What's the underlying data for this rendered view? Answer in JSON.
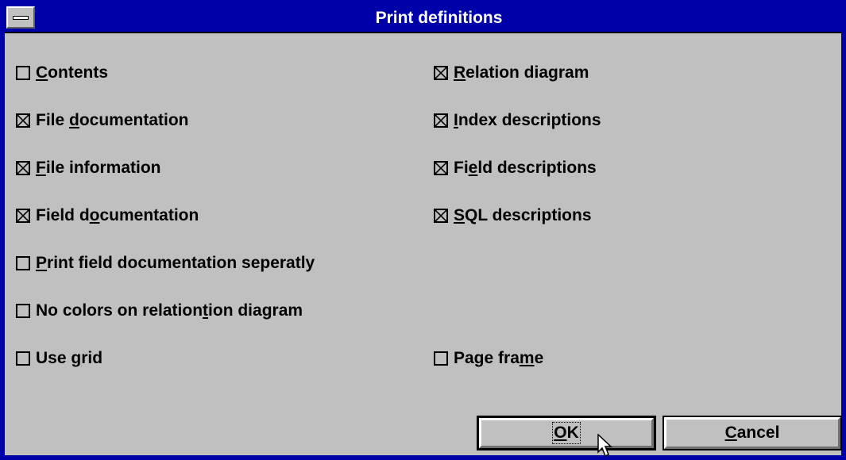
{
  "window": {
    "title": "Print definitions"
  },
  "options": [
    {
      "key": "contents",
      "before": "",
      "accel": "C",
      "after": "ontents",
      "checked": false
    },
    {
      "key": "file-doc",
      "before": "File ",
      "accel": "d",
      "after": "ocumentation",
      "checked": true
    },
    {
      "key": "file-info",
      "before": "",
      "accel": "F",
      "after": "ile information",
      "checked": true
    },
    {
      "key": "field-doc",
      "before": "Field d",
      "accel": "o",
      "after": "cumentation",
      "checked": true
    },
    {
      "key": "print-sep",
      "before": "",
      "accel": "P",
      "after": "rint field documentation seperatly",
      "checked": false
    },
    {
      "key": "no-colors",
      "before": "No colors on relation",
      "accel": "t",
      "after": "ion diagram",
      "checked": false
    },
    {
      "key": "use-grid",
      "before": "Use ",
      "accel": "g",
      "after": "rid",
      "checked": false
    },
    {
      "key": "relation-diag",
      "before": "",
      "accel": "R",
      "after": "elation diagram",
      "checked": true
    },
    {
      "key": "index-desc",
      "before": "",
      "accel": "I",
      "after": "ndex descriptions",
      "checked": true
    },
    {
      "key": "field-desc",
      "before": "Fi",
      "accel": "e",
      "after": "ld descriptions",
      "checked": true
    },
    {
      "key": "sql-desc",
      "before": "",
      "accel": "S",
      "after": "QL descriptions",
      "checked": true
    },
    {
      "key": "page-frame",
      "before": "Page fra",
      "accel": "m",
      "after": "e",
      "checked": false
    }
  ],
  "buttons": {
    "ok": {
      "accel": "O",
      "after": "K"
    },
    "cancel": {
      "accel": "C",
      "after": "ancel"
    }
  }
}
